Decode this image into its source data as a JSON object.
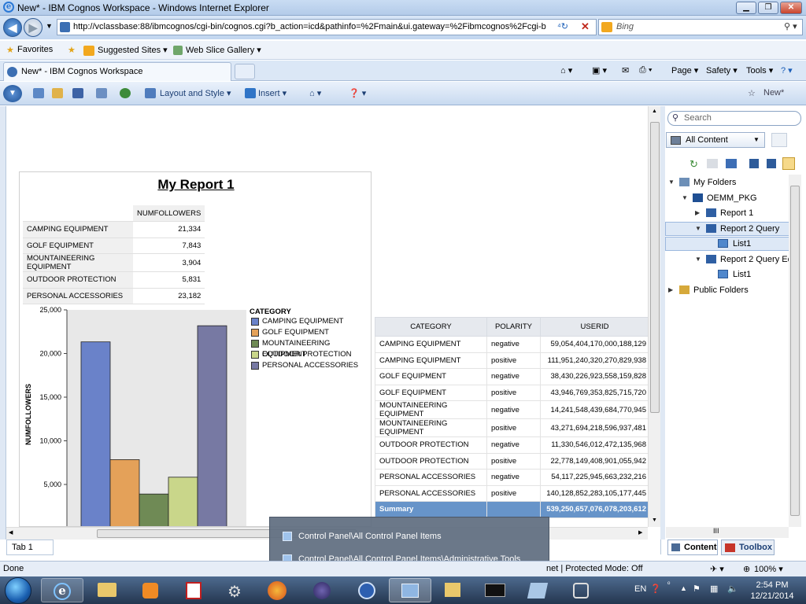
{
  "window": {
    "title": "New* - IBM Cognos Workspace - Windows Internet Explorer"
  },
  "address": {
    "url": "http://vclassbase:88/ibmcognos/cgi-bin/cognos.cgi?b_action=icd&pathinfo=%2Fmain&ui.gateway=%2Fibmcognos%2Fcgi-b",
    "search_placeholder": "Bing"
  },
  "favorites": {
    "favorites_label": "Favorites",
    "suggested_sites": "Suggested Sites ▾",
    "web_slice_gallery": "Web Slice Gallery ▾"
  },
  "browser_tab": {
    "label": "New* - IBM Cognos Workspace"
  },
  "commandbar": {
    "page": "Page ▾",
    "safety": "Safety ▾",
    "tools": "Tools ▾"
  },
  "cognos_toolbar": {
    "layout_and_style": "Layout and Style ▾",
    "insert": "Insert ▾",
    "new_label": "New*"
  },
  "report": {
    "title": "My Report 1",
    "crosstab": {
      "measure_header": "NUMFOLLOWERS",
      "rows": [
        {
          "label": "CAMPING EQUIPMENT",
          "value": "21,334"
        },
        {
          "label": "GOLF EQUIPMENT",
          "value": "7,843"
        },
        {
          "label": "MOUNTAINEERING EQUIPMENT",
          "value": "3,904"
        },
        {
          "label": "OUTDOOR PROTECTION",
          "value": "5,831"
        },
        {
          "label": "PERSONAL ACCESSORIES",
          "value": "23,182"
        }
      ]
    },
    "legend_title": "CATEGORY"
  },
  "chart_data": {
    "type": "bar",
    "categories": [
      "CAMPING EQUIPMENT",
      "GOLF EQUIPMENT",
      "MOUNTAINEERING EQUIPMENT",
      "OUTDOOR PROTECTION",
      "PERSONAL ACCESSORIES"
    ],
    "values": [
      21334,
      7843,
      3904,
      5831,
      23182
    ],
    "colors": [
      "#6a82c9",
      "#e4a159",
      "#6f8a55",
      "#c9d68a",
      "#7779a3"
    ],
    "ylabel": "NUMFOLLOWERS",
    "yticks": [
      5000,
      10000,
      15000,
      20000,
      25000
    ],
    "ytick_labels": [
      "5,000",
      "10,000",
      "15,000",
      "20,000",
      "25,000"
    ],
    "legend_title": "CATEGORY",
    "legend_position": "right"
  },
  "list": {
    "headers": [
      "CATEGORY",
      "POLARITY",
      "USERID"
    ],
    "rows": [
      [
        "CAMPING EQUIPMENT",
        "negative",
        "59,054,404,170,000,188,129"
      ],
      [
        "CAMPING EQUIPMENT",
        "positive",
        "111,951,240,320,270,829,938"
      ],
      [
        "GOLF EQUIPMENT",
        "negative",
        "38,430,226,923,558,159,828"
      ],
      [
        "GOLF EQUIPMENT",
        "positive",
        "43,946,769,353,825,715,720"
      ],
      [
        "MOUNTAINEERING EQUIPMENT",
        "negative",
        "14,241,548,439,684,770,945"
      ],
      [
        "MOUNTAINEERING EQUIPMENT",
        "positive",
        "43,271,694,218,596,937,481"
      ],
      [
        "OUTDOOR PROTECTION",
        "negative",
        "11,330,546,012,472,135,968"
      ],
      [
        "OUTDOOR PROTECTION",
        "positive",
        "22,778,149,408,901,055,942"
      ],
      [
        "PERSONAL ACCESSORIES",
        "negative",
        "54,117,225,945,663,232,216"
      ],
      [
        "PERSONAL ACCESSORIES",
        "positive",
        "140,128,852,283,105,177,445"
      ]
    ],
    "summary_label": "Summary",
    "summary_value": "539,250,657,076,078,203,612"
  },
  "sidepane": {
    "search_placeholder": "Search",
    "content_select": "All Content",
    "tree": [
      "My Folders",
      "OEMM_PKG",
      "Report 1",
      "Report 2 Query",
      "List1",
      "Report 2 Query Ec",
      "List1",
      "Public Folders"
    ],
    "tab_content": "Content",
    "tab_toolbox": "Toolbox",
    "hscroll_grip": "III"
  },
  "tab1": "Tab 1",
  "popup": {
    "item1": "Control Panel\\All Control Panel Items",
    "item2": "Control Panel\\All Control Panel Items\\Administrative Tools"
  },
  "status": {
    "left": "Done",
    "middle": "net | Protected Mode: Off",
    "zoom": "100% ▾"
  },
  "taskbar": {
    "lang": "EN",
    "time": "2:54 PM",
    "date": "12/21/2014"
  }
}
